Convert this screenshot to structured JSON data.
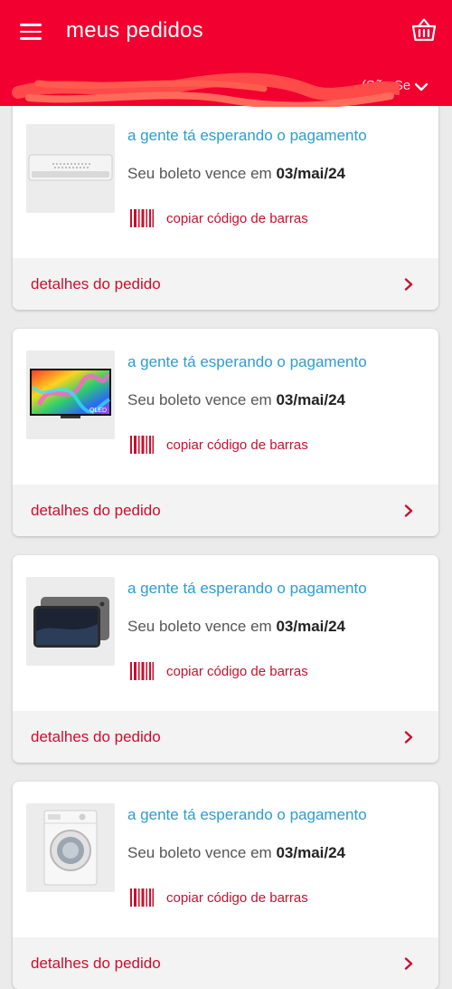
{
  "header": {
    "title": "meus pedidos",
    "address_visible_fragment": "(São Se"
  },
  "icons": {
    "menu": "hamburger-menu-icon",
    "basket": "basket-icon",
    "address_toggle": "chevron-down-icon",
    "barcode": "barcode-icon",
    "details": "chevron-right-icon"
  },
  "colors": {
    "brand_red": "#f2002f",
    "status_blue": "#2d9cd3",
    "link_red": "#c8102e"
  },
  "orders": [
    {
      "product": "air-conditioner",
      "status": "a gente tá esperando o pagamento",
      "due_prefix": "Seu boleto vence em ",
      "due_date": "03/mai/24",
      "copy_label": "copiar código de barras",
      "details_label": "detalhes do pedido"
    },
    {
      "product": "qled-tv",
      "status": "a gente tá esperando o pagamento",
      "due_prefix": "Seu boleto vence em ",
      "due_date": "03/mai/24",
      "copy_label": "copiar código de barras",
      "details_label": "detalhes do pedido"
    },
    {
      "product": "tablet",
      "status": "a gente tá esperando o pagamento",
      "due_prefix": "Seu boleto vence em ",
      "due_date": "03/mai/24",
      "copy_label": "copiar código de barras",
      "details_label": "detalhes do pedido"
    },
    {
      "product": "washing-machine",
      "status": "a gente tá esperando o pagamento",
      "due_prefix": "Seu boleto vence em ",
      "due_date": "03/mai/24",
      "copy_label": "copiar código de barras",
      "details_label": "detalhes do pedido"
    }
  ]
}
